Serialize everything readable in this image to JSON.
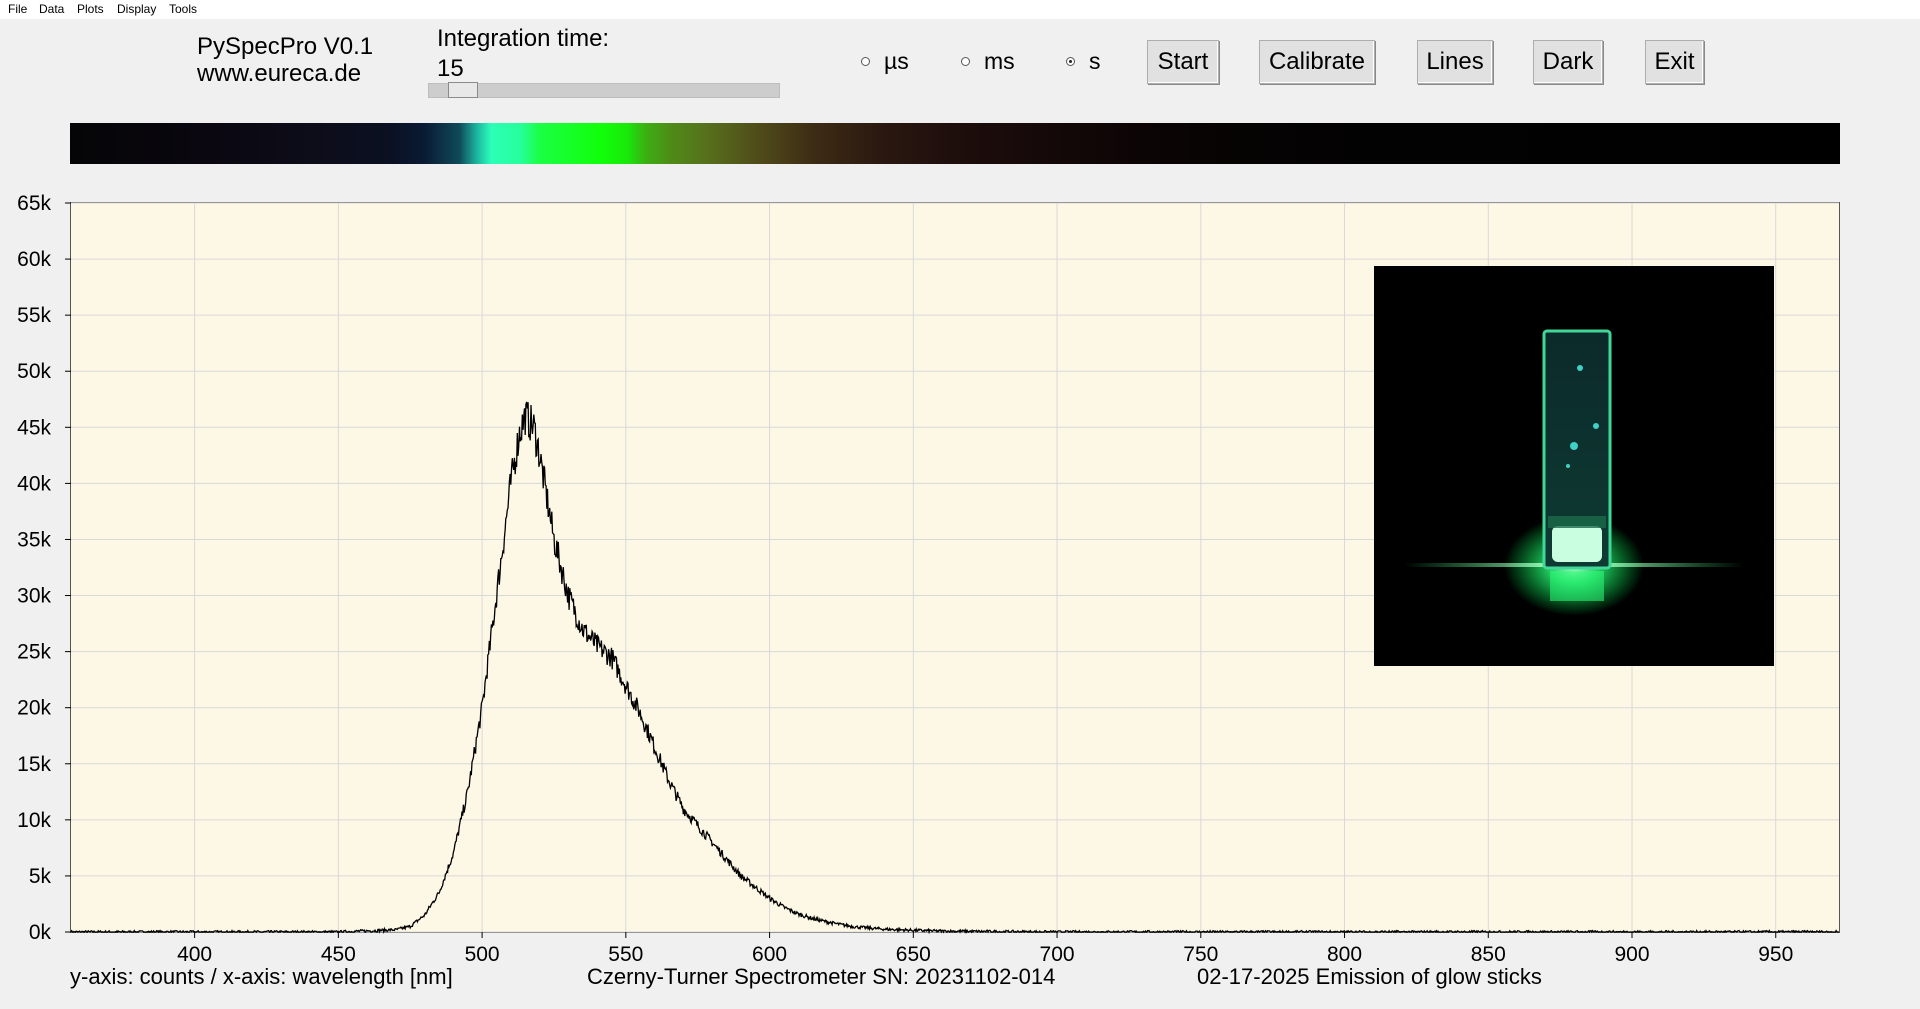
{
  "menu": {
    "items": [
      "File",
      "Data",
      "Plots",
      "Display",
      "Tools"
    ]
  },
  "app": {
    "title": "PySpecPro V0.1",
    "website": "www.eureca.de"
  },
  "integration": {
    "label": "Integration time:",
    "value": "15",
    "slider_fraction": 0.05
  },
  "units": {
    "options": [
      {
        "label": "µs",
        "selected": false
      },
      {
        "label": "ms",
        "selected": false
      },
      {
        "label": "s",
        "selected": true
      }
    ]
  },
  "buttons": {
    "start": "Start",
    "calibrate": "Calibrate",
    "lines": "Lines",
    "dark": "Dark",
    "exit": "Exit"
  },
  "footer": {
    "axes_note": "y-axis: counts / x-axis: wavelength [nm]",
    "spectrometer": "Czerny-Turner Spectrometer SN: 20231102-014",
    "description": "02-17-2025 Emission of glow sticks"
  },
  "colors": {
    "plot_background": "#fdf8e6",
    "grid": "#d8d8d8",
    "trace": "#000000",
    "glow": "#2dff7a"
  },
  "chart_data": {
    "type": "line",
    "xlim": [
      357,
      972
    ],
    "ylim": [
      0,
      65000
    ],
    "x_ticks": [
      400,
      450,
      500,
      550,
      600,
      650,
      700,
      750,
      800,
      850,
      900,
      950
    ],
    "x_tick_labels": [
      "400",
      "450",
      "500",
      "550",
      "600",
      "650",
      "700",
      "750",
      "800",
      "850",
      "900",
      "950"
    ],
    "y_ticks": [
      0,
      5000,
      10000,
      15000,
      20000,
      25000,
      30000,
      35000,
      40000,
      45000,
      50000,
      55000,
      60000,
      65000
    ],
    "y_tick_labels": [
      "0k",
      "5k",
      "10k",
      "15k",
      "20k",
      "25k",
      "30k",
      "35k",
      "40k",
      "45k",
      "50k",
      "55k",
      "60k",
      "65k"
    ],
    "grid": true,
    "series": [
      {
        "x": [
          357,
          400,
          450,
          470,
          475,
          480,
          485,
          490,
          495,
          500,
          505,
          510,
          513,
          515,
          518,
          520,
          525,
          530,
          535,
          540,
          545,
          550,
          555,
          560,
          565,
          570,
          575,
          580,
          585,
          590,
          595,
          600,
          605,
          610,
          615,
          620,
          625,
          630,
          640,
          650,
          660,
          680,
          700,
          750,
          800,
          850,
          900,
          950,
          972
        ],
        "y": [
          0,
          0,
          0,
          200,
          500,
          1500,
          3500,
          7000,
          12500,
          20000,
          30000,
          40000,
          44500,
          46000,
          45000,
          42500,
          35000,
          30000,
          27000,
          25500,
          24500,
          22000,
          19500,
          16500,
          13500,
          11000,
          9500,
          8000,
          6500,
          5000,
          4000,
          3000,
          2200,
          1600,
          1200,
          900,
          650,
          450,
          250,
          150,
          80,
          30,
          0,
          0,
          0,
          0,
          0,
          0,
          0
        ]
      }
    ]
  }
}
